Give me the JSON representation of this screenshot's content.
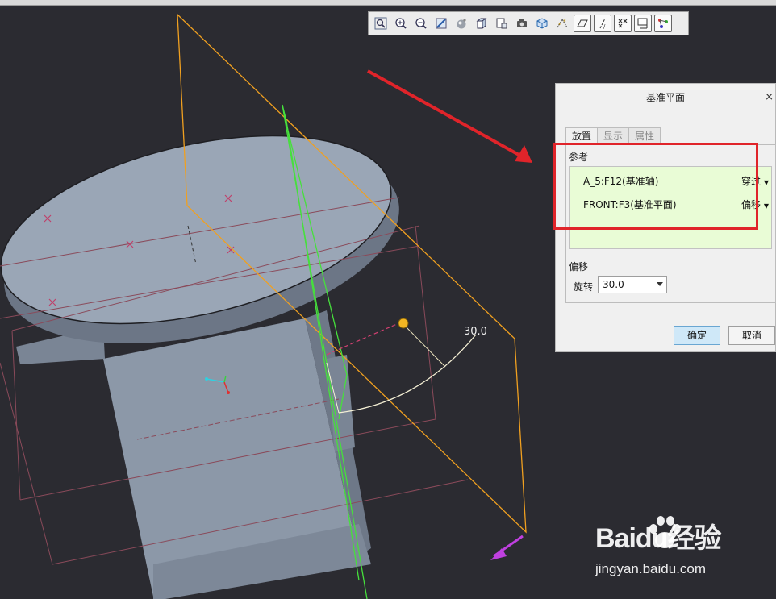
{
  "toolbar": {
    "icons": [
      "refit-icon",
      "zoom-in-icon",
      "zoom-out-icon",
      "repaint-icon",
      "shading-icon",
      "saved-orientations-icon",
      "view-manager-icon",
      "perspective-icon",
      "display-style-icon",
      "datum-display-icon",
      "plane-display-icon",
      "axis-display-icon",
      "point-display-icon",
      "csys-display-icon",
      "annotation-display-icon"
    ]
  },
  "dialog": {
    "title": "基准平面",
    "close_glyph": "×",
    "tabs": [
      "放置",
      "显示",
      "属性"
    ],
    "references_label": "参考",
    "references": [
      {
        "name": "A_5:F12(基准轴)",
        "constraint": "穿过"
      },
      {
        "name": "FRONT:F3(基准平面)",
        "constraint": "偏移"
      }
    ],
    "offset_label": "偏移",
    "rotation_label": "旋转",
    "rotation_value": "30.0",
    "ok_label": "确定",
    "cancel_label": "取消"
  },
  "viewport": {
    "dimension_label": "30.0"
  },
  "watermark": {
    "brand": "Baidu经验",
    "url": "jingyan.baidu.com"
  },
  "colors": {
    "background": "#2b2b31",
    "model": "#8e9aaa",
    "new_plane": "#f0a020",
    "axis": "#46e03c",
    "annotation": "#e0242a"
  }
}
